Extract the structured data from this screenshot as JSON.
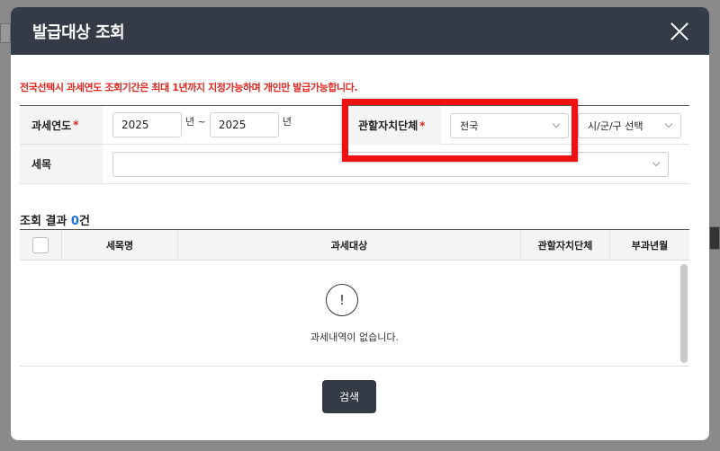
{
  "modal": {
    "title": "발급대상 조회",
    "notice": "전국선택시 과세연도 조회기간은 최대 1년까지 지정가능하며 개인만 발급가능합니다."
  },
  "form": {
    "tax_year_label": "과세연도",
    "required_mark": "*",
    "year_from": "2025",
    "year_from_unit": "년 ~",
    "year_to": "2025",
    "year_to_unit": "년",
    "region_label": "관할자치단체",
    "region_value": "전국",
    "district_placeholder": "시/군/구 선택",
    "tax_item_label": "세목",
    "tax_item_value": ""
  },
  "results": {
    "title_prefix": "조회 결과 ",
    "count": "0",
    "title_suffix": "건",
    "columns": [
      "세목명",
      "과세대상",
      "관할자치단체",
      "부과년월"
    ],
    "empty_icon": "!",
    "empty_message": "과세내역이 없습니다."
  },
  "actions": {
    "search_label": "검색"
  },
  "colors": {
    "header_bg": "#353a47",
    "notice_red": "#e0261f",
    "highlight_red": "#ef1111",
    "count_blue": "#1b6ee0"
  }
}
